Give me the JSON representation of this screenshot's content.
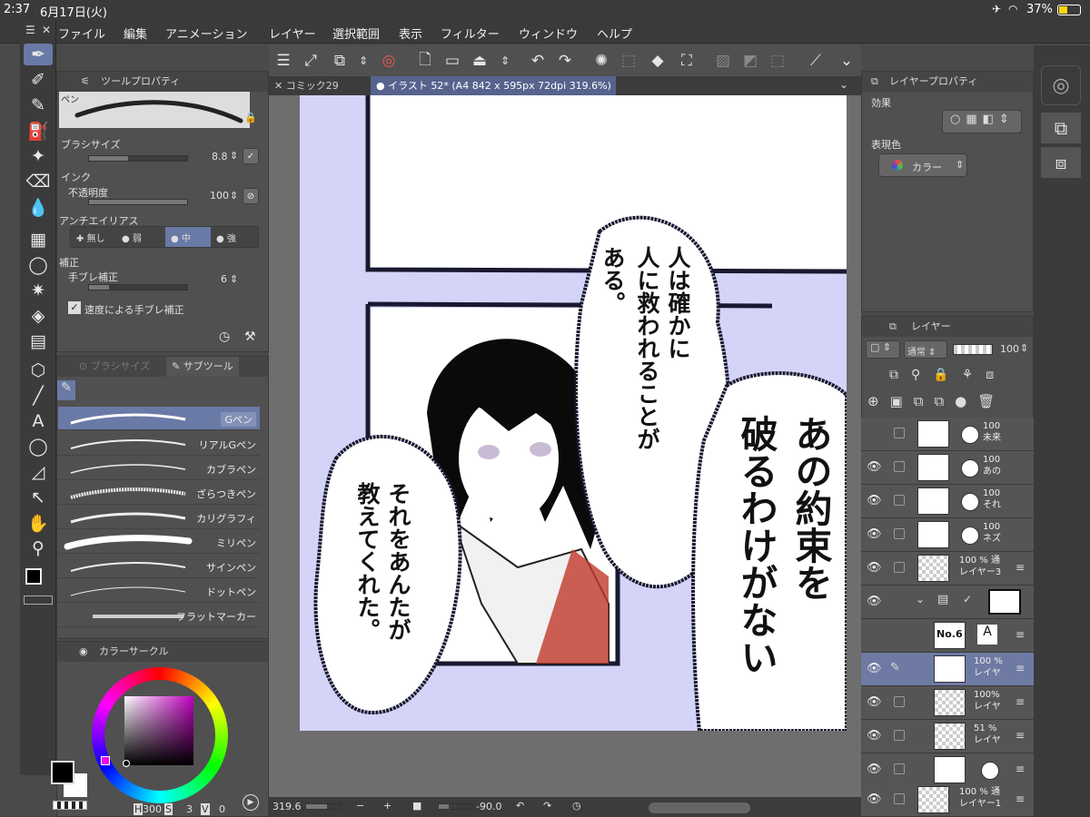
{
  "status": {
    "time": "2:37",
    "date": "6月17日(火)",
    "battery": "37%"
  },
  "menu": [
    "ファイル",
    "編集",
    "アニメーション",
    "レイヤー",
    "選択範囲",
    "表示",
    "フィルター",
    "ウィンドウ",
    "ヘルプ"
  ],
  "tabs": [
    {
      "label": "コミック29",
      "active": false
    },
    {
      "label": "イラスト 52* (A4 842 x 595px 72dpi 319.6%)",
      "active": true
    }
  ],
  "tool_property": {
    "title": "ツールプロパティ",
    "tool_name": "ペン",
    "brush_size_label": "ブラシサイズ",
    "brush_size_value": "8.8",
    "ink_label": "インク",
    "opacity_label": "不透明度",
    "opacity_value": "100",
    "antialias_label": "アンチエイリアス",
    "antialias_options": [
      "無し",
      "弱",
      "中",
      "強"
    ],
    "antialias_selected": 2,
    "correction_label": "補正",
    "stabilization_label": "手ブレ補正",
    "stabilization_value": "6",
    "speed_stabilization_label": "速度による手ブレ補正"
  },
  "subtool": {
    "tab_brushsize": "ブラシサイズ",
    "tab_subtool": "サブツール",
    "brushes": [
      "Gペン",
      "リアルGペン",
      "カブラペン",
      "ざらつきペン",
      "カリグラフィ",
      "ミリペン",
      "サインペン",
      "ドットペン",
      "フラットマーカー"
    ],
    "selected": 0
  },
  "color_circle": {
    "title": "カラーサークル",
    "h_label": "H",
    "h_value": "300",
    "s_label": "S",
    "s_value": "3",
    "v_label": "V",
    "v_value": "0",
    "accent": "#c060c0"
  },
  "layer_property": {
    "title": "レイヤープロパティ",
    "effect_label": "効果",
    "expression_label": "表現色",
    "expression_value": "カラー"
  },
  "layer_panel": {
    "title": "レイヤー",
    "blend_mode": "通常",
    "opacity": "100",
    "layers": [
      {
        "line1": "100",
        "line2": "未来",
        "selected": false,
        "visible": false
      },
      {
        "line1": "100",
        "line2": "あの",
        "selected": false,
        "visible": true
      },
      {
        "line1": "100",
        "line2": "それ",
        "selected": false,
        "visible": true
      },
      {
        "line1": "100",
        "line2": "ネズ",
        "selected": false,
        "visible": true
      },
      {
        "line1": "100 % 通",
        "line2": "レイヤー3",
        "selected": false,
        "visible": true
      },
      {
        "line1": "",
        "line2": "",
        "selected": false,
        "visible": true
      },
      {
        "line1": "",
        "line2": "",
        "selected": false,
        "visible": false
      },
      {
        "line1": "100 %",
        "line2": "レイヤ",
        "selected": true,
        "visible": true
      },
      {
        "line1": "100%",
        "line2": "レイヤ",
        "selected": false,
        "visible": true
      },
      {
        "line1": "51 %",
        "line2": "レイヤ",
        "selected": false,
        "visible": true
      },
      {
        "line1": "",
        "line2": "",
        "selected": false,
        "visible": true
      },
      {
        "line1": "100 % 通",
        "line2": "レイヤー1",
        "selected": false,
        "visible": true
      }
    ]
  },
  "canvas": {
    "text_right_col1": "あの約束を",
    "text_right_col2": "破るわけがない",
    "text_mid_col1": "人は確かに",
    "text_mid_col2": "人に救われることが",
    "text_mid_col3": "ある。",
    "text_left_col1": "それをあんたが",
    "text_left_col2": "教えてくれた。",
    "thumb_label": "No.6"
  },
  "bottom_bar": {
    "zoom": "319.6",
    "angle": "-90.0"
  }
}
